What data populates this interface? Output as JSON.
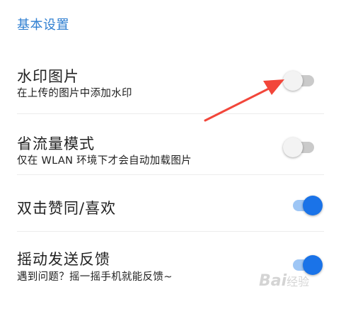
{
  "section": {
    "title": "基本设置"
  },
  "settings": [
    {
      "title": "水印图片",
      "subtitle": "在上传的图片中添加水印",
      "enabled": false
    },
    {
      "title": "省流量模式",
      "subtitle": "仅在 WLAN 环境下才会自动加载图片",
      "enabled": false
    },
    {
      "title": "双击赞同/喜欢",
      "subtitle": "",
      "enabled": true
    },
    {
      "title": "摇动发送反馈",
      "subtitle": "遇到问题？摇一摇手机就能反馈~",
      "enabled": true
    }
  ],
  "colors": {
    "accent": "#1a73e8",
    "header": "#2f7fd1",
    "arrow": "#f2463a"
  },
  "watermark": {
    "text": "Bai",
    "suffix": "经验"
  }
}
